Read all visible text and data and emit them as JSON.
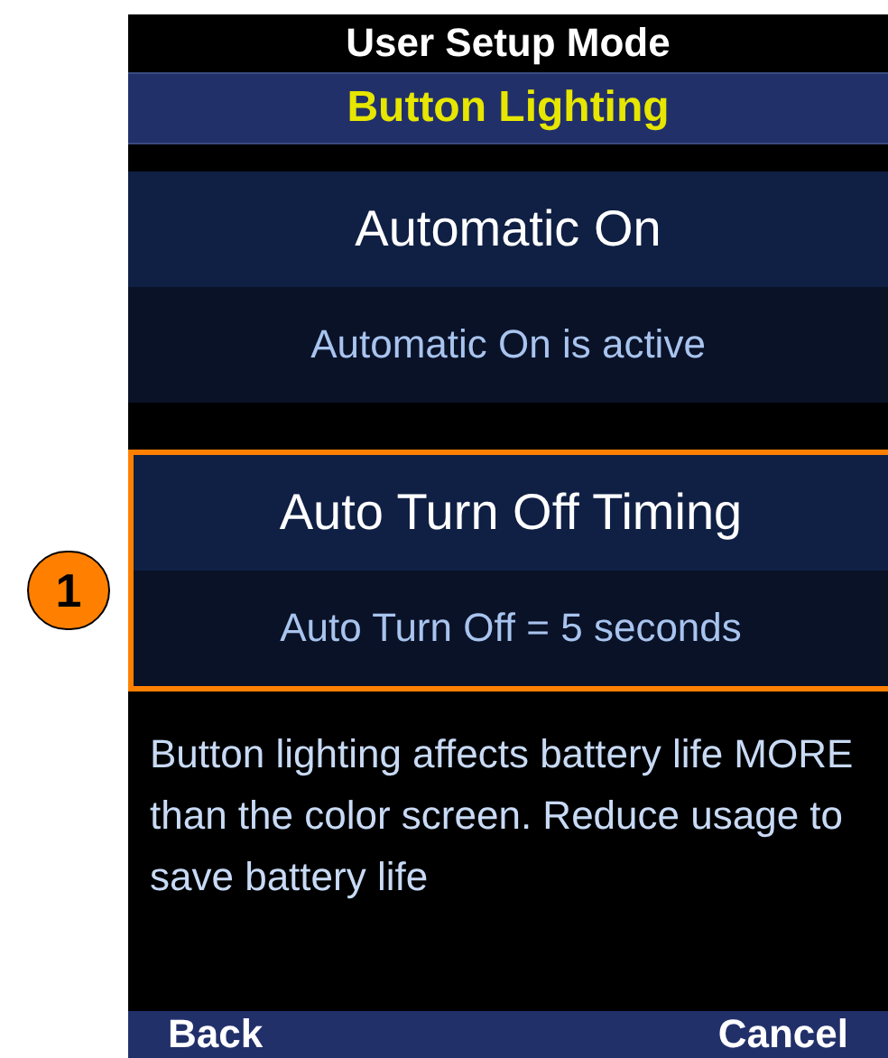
{
  "header": {
    "title": "User Setup Mode",
    "subtitle": "Button Lighting"
  },
  "options": [
    {
      "title": "Automatic On",
      "status": "Automatic On is active",
      "highlighted": false
    },
    {
      "title": "Auto Turn Off Timing",
      "status": "Auto Turn Off = 5 seconds",
      "highlighted": true
    }
  ],
  "callout": {
    "label": "1"
  },
  "note": "Button lighting affects battery life MORE than the color screen. Reduce usage to save battery life",
  "softkeys": [
    {
      "label": "Back"
    },
    {
      "label": "Cancel"
    }
  ]
}
